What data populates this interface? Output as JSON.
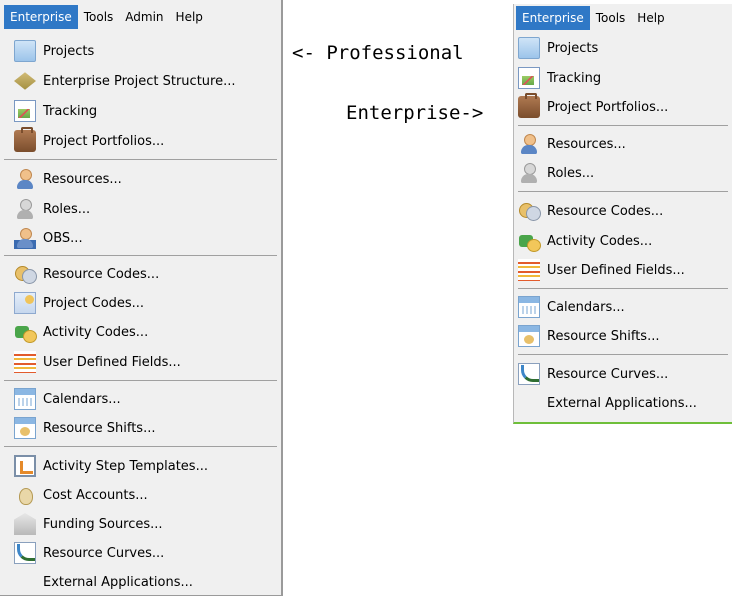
{
  "left_menu": {
    "menubar": [
      "Enterprise",
      "Tools",
      "Admin",
      "Help"
    ],
    "items": [
      {
        "label": "Projects",
        "icon": "folder-icon"
      },
      {
        "label": "Enterprise Project Structure...",
        "icon": "eps-icon"
      },
      {
        "label": "Tracking",
        "icon": "tracking-icon"
      },
      {
        "label": "Project Portfolios...",
        "icon": "portfolio-icon"
      },
      {
        "label": "Resources...",
        "icon": "resource-person-icon"
      },
      {
        "label": "Roles...",
        "icon": "role-person-icon"
      },
      {
        "label": "OBS...",
        "icon": "obs-icon"
      },
      {
        "label": "Resource Codes...",
        "icon": "resource-codes-icon"
      },
      {
        "label": "Project Codes...",
        "icon": "project-codes-icon"
      },
      {
        "label": "Activity Codes...",
        "icon": "activity-codes-icon"
      },
      {
        "label": "User Defined Fields...",
        "icon": "user-defined-fields-icon"
      },
      {
        "label": "Calendars...",
        "icon": "calendar-icon"
      },
      {
        "label": "Resource Shifts...",
        "icon": "resource-shifts-icon"
      },
      {
        "label": "Activity Step Templates...",
        "icon": "activity-steps-icon"
      },
      {
        "label": "Cost Accounts...",
        "icon": "cost-accounts-icon"
      },
      {
        "label": "Funding Sources...",
        "icon": "funding-sources-icon"
      },
      {
        "label": "Resource Curves...",
        "icon": "resource-curves-icon"
      },
      {
        "label": "External Applications...",
        "icon": ""
      }
    ]
  },
  "right_menu": {
    "menubar": [
      "Enterprise",
      "Tools",
      "Help"
    ],
    "items": [
      {
        "label": "Projects",
        "icon": "folder-icon"
      },
      {
        "label": "Tracking",
        "icon": "tracking-icon"
      },
      {
        "label": "Project Portfolios...",
        "icon": "portfolio-icon"
      },
      {
        "label": "Resources...",
        "icon": "resource-person-icon"
      },
      {
        "label": "Roles...",
        "icon": "role-person-icon"
      },
      {
        "label": "Resource Codes...",
        "icon": "resource-codes-icon"
      },
      {
        "label": "Activity Codes...",
        "icon": "activity-codes-icon"
      },
      {
        "label": "User Defined Fields...",
        "icon": "user-defined-fields-icon"
      },
      {
        "label": "Calendars...",
        "icon": "calendar-icon"
      },
      {
        "label": "Resource Shifts...",
        "icon": "resource-shifts-icon"
      },
      {
        "label": "Resource Curves...",
        "icon": "resource-curves-icon"
      },
      {
        "label": "External Applications...",
        "icon": ""
      }
    ]
  },
  "captions": {
    "professional": "<- Professional",
    "enterprise": "Enterprise->"
  },
  "colors": {
    "menu_bg": "#f0f0f0",
    "menubar_active": "#2f78c6",
    "separator": "#a0a0a0"
  }
}
